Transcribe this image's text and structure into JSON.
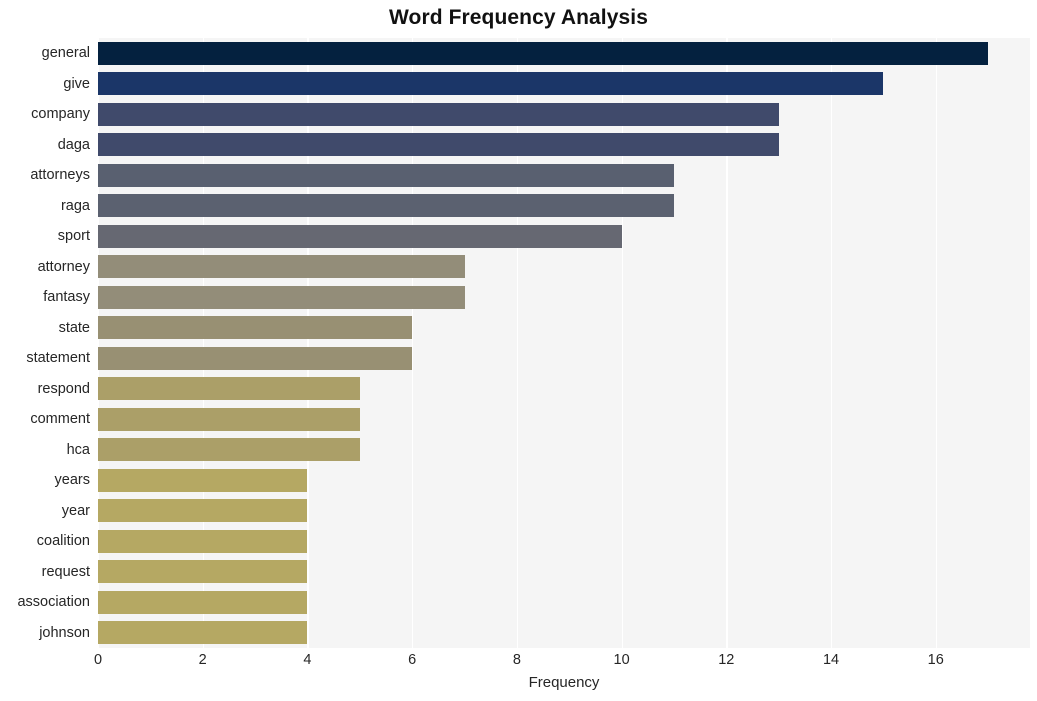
{
  "chart_data": {
    "type": "bar",
    "orientation": "horizontal",
    "title": "Word Frequency Analysis",
    "xlabel": "Frequency",
    "ylabel": "",
    "xlim": [
      0,
      17.8
    ],
    "xticks": [
      0,
      2,
      4,
      6,
      8,
      10,
      12,
      14,
      16
    ],
    "xtick_labels": [
      "0",
      "2",
      "4",
      "6",
      "8",
      "10",
      "12",
      "14",
      "16"
    ],
    "grid": true,
    "grid_axis": "x",
    "legend": null,
    "categories": [
      "general",
      "give",
      "company",
      "daga",
      "attorneys",
      "raga",
      "sport",
      "attorney",
      "fantasy",
      "state",
      "statement",
      "respond",
      "comment",
      "hca",
      "years",
      "year",
      "coalition",
      "request",
      "association",
      "johnson"
    ],
    "values": [
      17,
      15,
      13,
      13,
      11,
      11,
      10,
      7,
      7,
      6,
      6,
      5,
      5,
      5,
      4,
      4,
      4,
      4,
      4,
      4
    ],
    "bar_colors": [
      "#04213f",
      "#1b3668",
      "#404a6b",
      "#404a6b",
      "#596070",
      "#5b6170",
      "#666872",
      "#938d79",
      "#938d79",
      "#989073",
      "#989073",
      "#ab9f68",
      "#ab9f68",
      "#ab9f68",
      "#b5a863",
      "#b5a863",
      "#b5a863",
      "#b5a863",
      "#b5a863",
      "#b5a863"
    ],
    "plot_background": "#f5f5f5",
    "grid_color": "#ffffff",
    "figure_background": "#ffffff"
  }
}
